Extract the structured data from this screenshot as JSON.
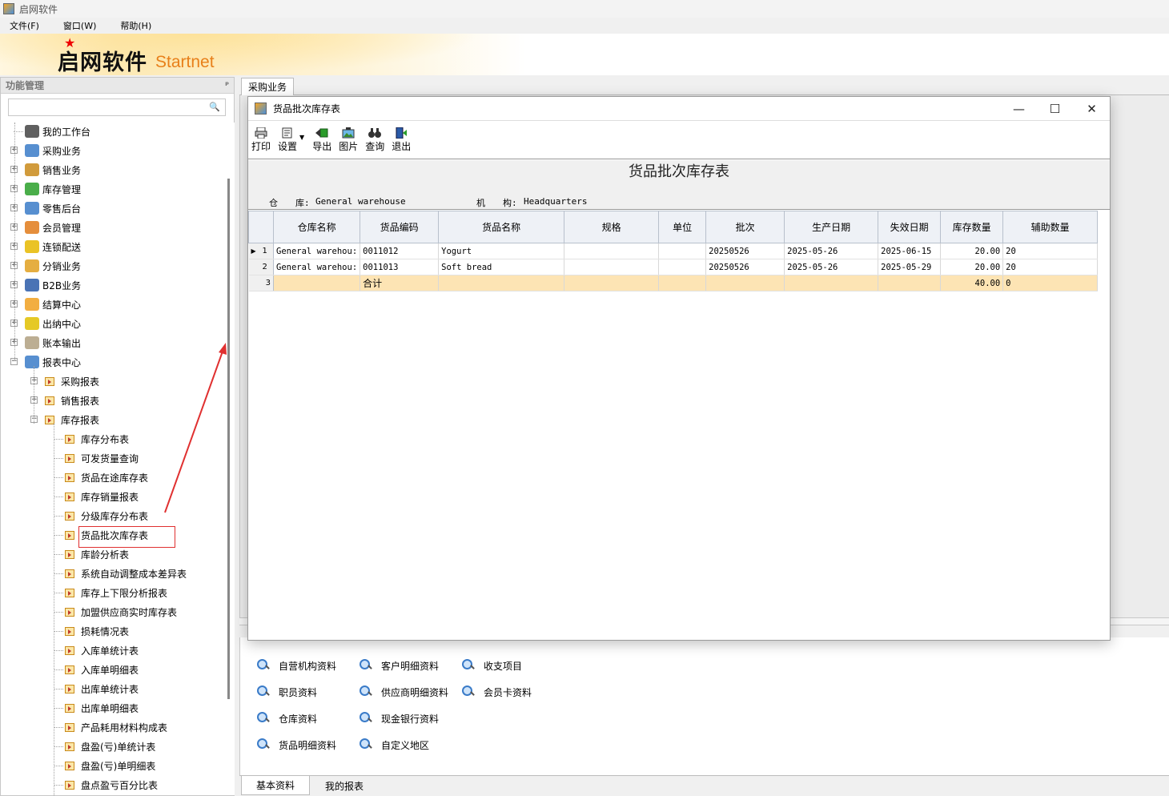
{
  "app": {
    "title": "启网软件"
  },
  "menu": [
    "文件(F)",
    "窗口(W)",
    "帮助(H)"
  ],
  "banner": {
    "logo_cn": "启网软件",
    "logo_en": "Startnet"
  },
  "left_panel": {
    "title": "功能管理",
    "search_placeholder": "",
    "tree": [
      {
        "label": "我的工作台",
        "level": 0,
        "expander": ""
      },
      {
        "label": "采购业务",
        "level": 0,
        "expander": "+"
      },
      {
        "label": "销售业务",
        "level": 0,
        "expander": "+"
      },
      {
        "label": "库存管理",
        "level": 0,
        "expander": "+"
      },
      {
        "label": "零售后台",
        "level": 0,
        "expander": "+"
      },
      {
        "label": "会员管理",
        "level": 0,
        "expander": "+"
      },
      {
        "label": "连锁配送",
        "level": 0,
        "expander": "+"
      },
      {
        "label": "分销业务",
        "level": 0,
        "expander": "+"
      },
      {
        "label": "B2B业务",
        "level": 0,
        "expander": "+"
      },
      {
        "label": "结算中心",
        "level": 0,
        "expander": "+"
      },
      {
        "label": "出纳中心",
        "level": 0,
        "expander": "+"
      },
      {
        "label": "账本输出",
        "level": 0,
        "expander": "+"
      },
      {
        "label": "报表中心",
        "level": 0,
        "expander": "-"
      },
      {
        "label": "采购报表",
        "level": 1,
        "expander": "+"
      },
      {
        "label": "销售报表",
        "level": 1,
        "expander": "+"
      },
      {
        "label": "库存报表",
        "level": 1,
        "expander": "-"
      },
      {
        "label": "库存分布表",
        "level": 2,
        "expander": ""
      },
      {
        "label": "可发货量查询",
        "level": 2,
        "expander": ""
      },
      {
        "label": "货品在途库存表",
        "level": 2,
        "expander": ""
      },
      {
        "label": "库存销量报表",
        "level": 2,
        "expander": ""
      },
      {
        "label": "分级库存分布表",
        "level": 2,
        "expander": ""
      },
      {
        "label": "货品批次库存表",
        "level": 2,
        "expander": ""
      },
      {
        "label": "库龄分析表",
        "level": 2,
        "expander": ""
      },
      {
        "label": "系统自动调整成本差异表",
        "level": 2,
        "expander": ""
      },
      {
        "label": "库存上下限分析报表",
        "level": 2,
        "expander": ""
      },
      {
        "label": "加盟供应商实时库存表",
        "level": 2,
        "expander": ""
      },
      {
        "label": "损耗情况表",
        "level": 2,
        "expander": ""
      },
      {
        "label": "入库单统计表",
        "level": 2,
        "expander": ""
      },
      {
        "label": "入库单明细表",
        "level": 2,
        "expander": ""
      },
      {
        "label": "出库单统计表",
        "level": 2,
        "expander": ""
      },
      {
        "label": "出库单明细表",
        "level": 2,
        "expander": ""
      },
      {
        "label": "产品耗用材料构成表",
        "level": 2,
        "expander": ""
      },
      {
        "label": "盘盈(亏)单统计表",
        "level": 2,
        "expander": ""
      },
      {
        "label": "盘盈(亏)单明细表",
        "level": 2,
        "expander": ""
      },
      {
        "label": "盘点盈亏百分比表",
        "level": 2,
        "expander": ""
      }
    ]
  },
  "main_tab": "采购业务",
  "child_window": {
    "title": "货品批次库存表",
    "toolbar": [
      "打印",
      "设置",
      "导出",
      "图片",
      "查询",
      "退出"
    ],
    "report_title": "货品批次库存表",
    "meta_warehouse_label": "仓　　库:",
    "meta_warehouse_value": "General warehouse",
    "meta_org_label": "机　　构:",
    "meta_org_value": "Headquarters",
    "columns": [
      "仓库名称",
      "货品编码",
      "货品名称",
      "规格",
      "单位",
      "批次",
      "生产日期",
      "失效日期",
      "库存数量",
      "辅助数量"
    ],
    "rows": [
      {
        "no": "1",
        "marker": "▶",
        "cells": [
          "General warehou:",
          "0011012",
          "Yogurt",
          "",
          "",
          "20250526",
          "2025-05-26",
          "2025-06-15",
          "20.00",
          "20"
        ]
      },
      {
        "no": "2",
        "marker": "",
        "cells": [
          "General warehou:",
          "0011013",
          "Soft bread",
          "",
          "",
          "20250526",
          "2025-05-26",
          "2025-05-29",
          "20.00",
          "20"
        ]
      }
    ],
    "total": {
      "no": "3",
      "label": "合计",
      "qty": "40.00",
      "aux": "0"
    }
  },
  "quick_links": [
    [
      "自营机构资料",
      "职员资料",
      "仓库资料",
      "货品明细资料"
    ],
    [
      "客户明细资料",
      "供应商明细资料",
      "现金银行资料",
      "自定义地区"
    ],
    [
      "收支项目",
      "会员卡资料"
    ]
  ],
  "bottom_tabs": [
    "基本资料",
    "我的报表"
  ],
  "colors": {
    "highlight": "#e03030",
    "total_row": "#fde4b4",
    "logo_en": "#e8801a"
  }
}
